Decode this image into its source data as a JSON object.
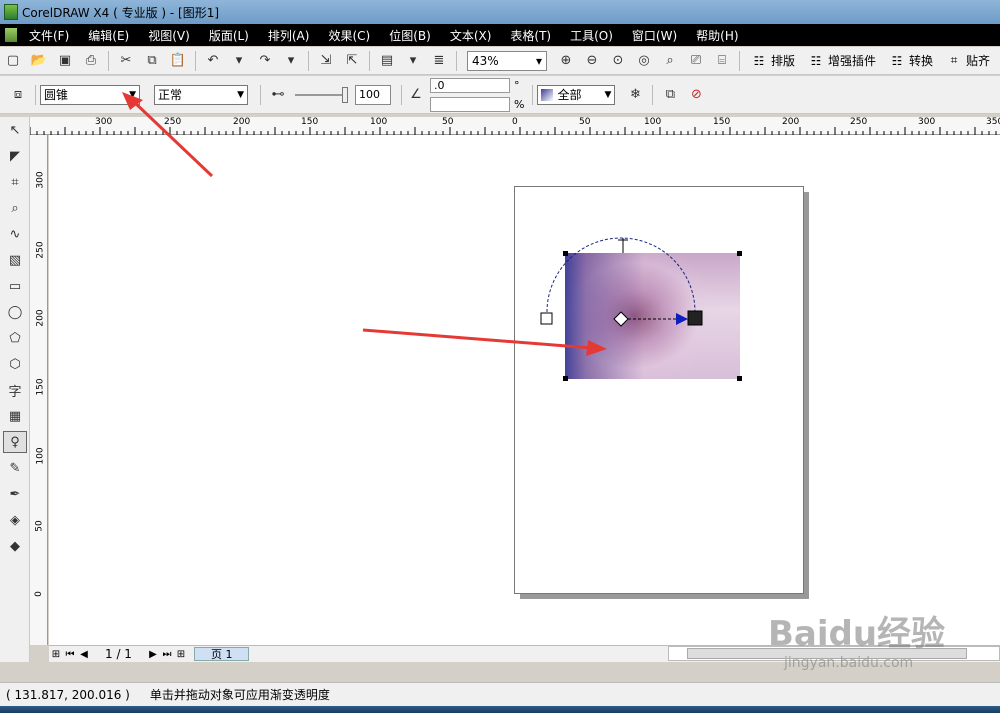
{
  "window": {
    "title": "CorelDRAW X4 ( 专业版 ) - [图形1]"
  },
  "menu": [
    "文件(F)",
    "编辑(E)",
    "视图(V)",
    "版面(L)",
    "排列(A)",
    "效果(C)",
    "位图(B)",
    "文本(X)",
    "表格(T)",
    "工具(O)",
    "窗口(W)",
    "帮助(H)"
  ],
  "toolbar": {
    "zoom": "43%",
    "text_buttons": [
      "排版",
      "增强插件",
      "转换",
      "贴齐"
    ]
  },
  "propbar": {
    "transparency_type": "圆锥",
    "operation": "正常",
    "midpoint_value": "100",
    "angle_value": ".0",
    "degree_symbol": "°",
    "percent_symbol": "%",
    "target": "全部"
  },
  "ruler": {
    "h_labels": [
      "300",
      "250",
      "200",
      "150",
      "100",
      "50",
      "0",
      "50",
      "100",
      "150",
      "200",
      "250",
      "300",
      "350"
    ],
    "v_labels": [
      "300",
      "250",
      "200",
      "150",
      "100",
      "50",
      "0"
    ]
  },
  "pagebar": {
    "page_count": "1 / 1",
    "page_tab": "页 1"
  },
  "status": {
    "coords": "( 131.817, 200.016 )",
    "message": "单击并拖动对象可应用渐变透明度"
  },
  "watermark": {
    "main": "Baidu经验",
    "sub": "jingyan.baidu.com"
  },
  "colors": {
    "menubar": "#000000",
    "arrow": "#e53935",
    "gradient_dark": "#3c3c96"
  }
}
